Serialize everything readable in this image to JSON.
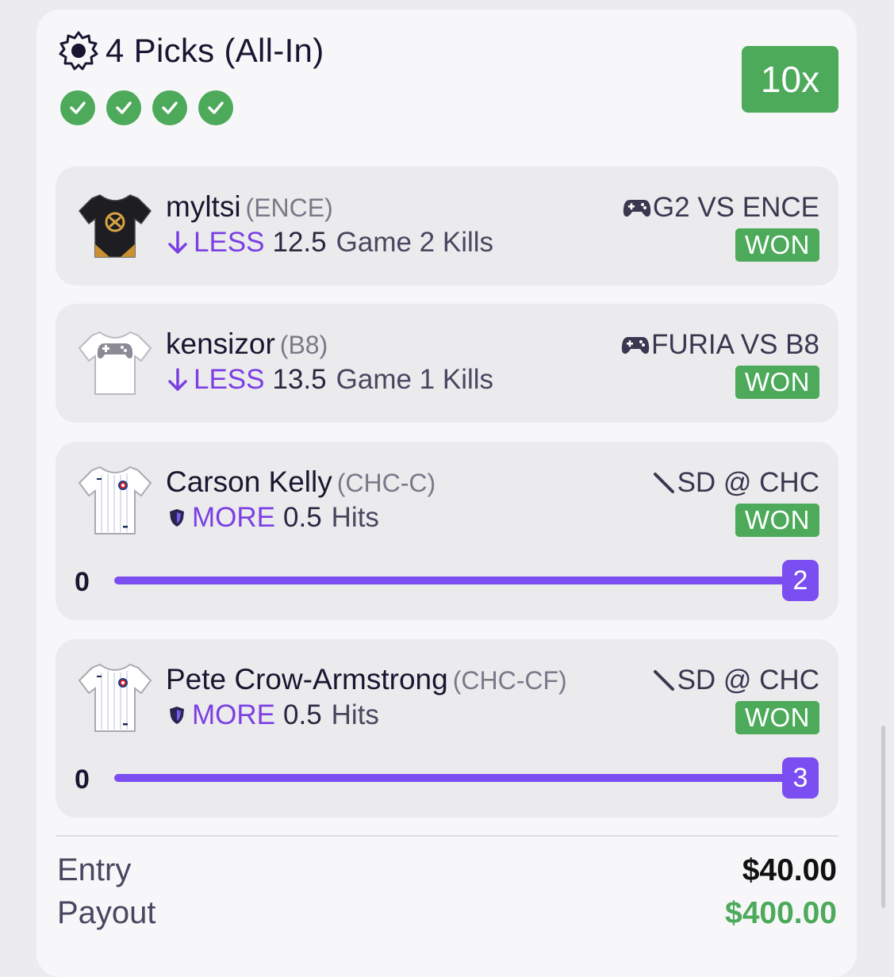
{
  "header": {
    "title": "4 Picks (All-In)",
    "icon": "badge-icon",
    "multiplier": "10x",
    "checks_count": 4
  },
  "picks": [
    {
      "name": "myltsi",
      "team": "(ENCE)",
      "direction": "LESS",
      "line_value": "12.5",
      "stat": "Game 2 Kills",
      "match": "G2 VS ENCE",
      "match_icon": "gamepad-icon",
      "result": "WON"
    },
    {
      "name": "kensizor",
      "team": "(B8)",
      "direction": "LESS",
      "line_value": "13.5",
      "stat": "Game 1 Kills",
      "match": "FURIA VS B8",
      "match_icon": "gamepad-icon",
      "result": "WON"
    },
    {
      "name": "Carson Kelly",
      "team": "(CHC-C)",
      "direction": "MORE",
      "line_value": "0.5",
      "stat": "Hits",
      "match": "SD @ CHC",
      "match_icon": "baseball-bat-icon",
      "result": "WON",
      "progress_min": "0",
      "progress_value": "2"
    },
    {
      "name": "Pete Crow-Armstrong",
      "team": "(CHC-CF)",
      "direction": "MORE",
      "line_value": "0.5",
      "stat": "Hits",
      "match": "SD @ CHC",
      "match_icon": "baseball-bat-icon",
      "result": "WON",
      "progress_min": "0",
      "progress_value": "3"
    }
  ],
  "footer": {
    "entry_label": "Entry",
    "entry_value": "$40.00",
    "payout_label": "Payout",
    "payout_value": "$400.00"
  },
  "colors": {
    "green": "#4caa5a",
    "purple": "#7a4ef0",
    "payout_green": "#4caa5a"
  }
}
